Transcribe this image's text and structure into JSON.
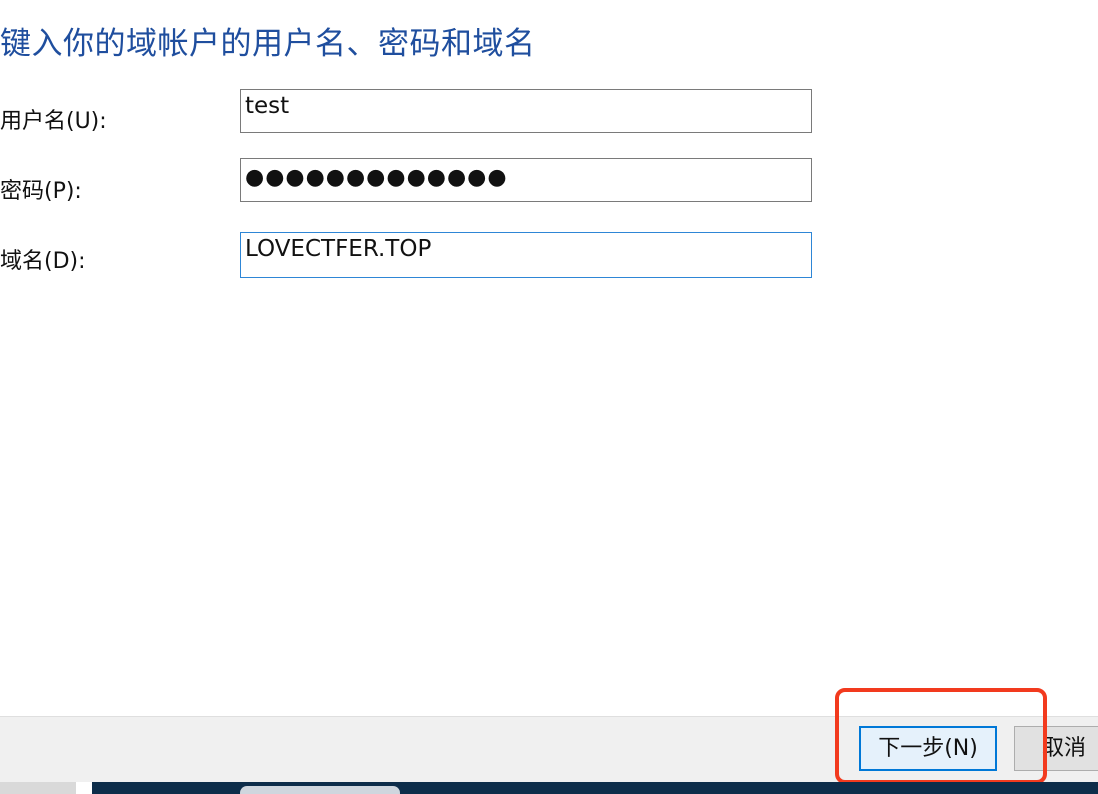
{
  "dialog": {
    "heading": "键入你的域帐户的用户名、密码和域名"
  },
  "form": {
    "username": {
      "label": "用户名(U):",
      "value": "test"
    },
    "password": {
      "label": "密码(P):",
      "value": "●●●●●●●●●●●●●"
    },
    "domain": {
      "label": "域名(D):",
      "value": "LOVECTFER.TOP"
    }
  },
  "buttons": {
    "next_label": "下一步(N)",
    "cancel_label": "取消"
  },
  "colors": {
    "heading": "#1f4e9e",
    "focus_border": "#2e86d6",
    "primary_border": "#0078d7",
    "annotation": "#f23a1e"
  }
}
